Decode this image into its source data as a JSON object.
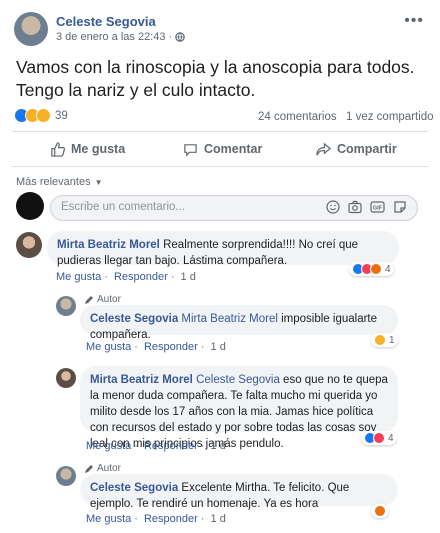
{
  "post": {
    "author": "Celeste Segovia",
    "timestamp": "3 de enero a las 22:43",
    "separator": "·",
    "text": "Vamos con la rinoscopia y la anoscopia para todos. Tengo la nariz y el culo intacto.",
    "reaction_count": "39",
    "comment_count": "24 comentarios",
    "share_count": "1 vez compartido",
    "more_icon": "more-dots-icon"
  },
  "actions": {
    "like": "Me gusta",
    "comment": "Comentar",
    "share": "Compartir"
  },
  "comments_header": {
    "sort": "Más relevantes",
    "input_placeholder": "Escribe un comentario..."
  },
  "comments": [
    {
      "name": "Mirta Beatriz Morel",
      "text": "Realmente sorprendida!!!! No creí que pudieras llegar tan bajo. Lástima compañera.",
      "like": "Me gusta",
      "reply": "Responder",
      "time": "1 d",
      "reactions": "4"
    },
    {
      "author_tag": "Autor",
      "name": "Celeste Segovia",
      "mention": "Mirta Beatriz Morel",
      "text": "imposible igualarte compañera.",
      "like": "Me gusta",
      "reply": "Responder",
      "time": "1 d",
      "reactions": "1"
    },
    {
      "name": "Mirta Beatriz Morel",
      "mention": "Celeste Segovia",
      "text": "eso que no te quepa la menor duda compañera. Te falta mucho mi querida yo milito desde los 17 años con la mia. Jamas hice política con recursos del estado y por sobre todas las cosas soy leal con mis principios jamás pendulo.",
      "like": "Me gusta",
      "reply": "Responder",
      "time": "1 d",
      "reactions": "4"
    },
    {
      "author_tag": "Autor",
      "name": "Celeste Segovia",
      "text": "Excelente Mirtha. Te felicito. Que ejemplo. Te rendiré un homenaje. Ya es hora",
      "like": "Me gusta",
      "reply": "Responder",
      "time": "1 d"
    }
  ],
  "colors": {
    "link": "#385898",
    "like_blue": "#1877f2",
    "love_red": "#f33e58",
    "haha_yellow": "#f7b125",
    "angry_orange": "#e9710f"
  }
}
